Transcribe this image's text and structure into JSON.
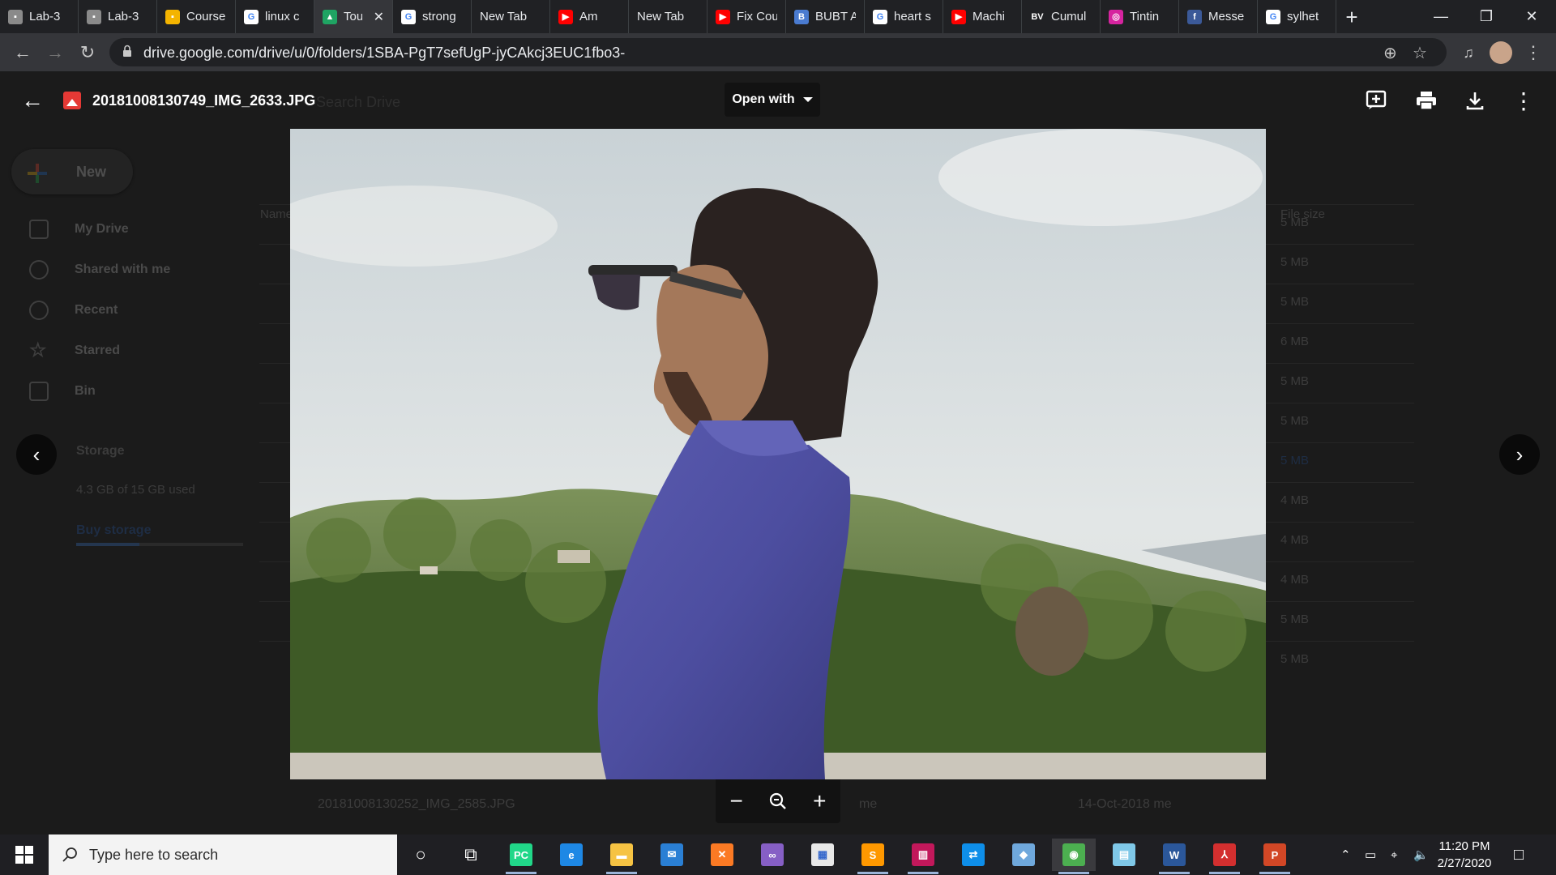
{
  "browser": {
    "tabs": [
      {
        "label": "Lab-3",
        "icon": "slides-icon",
        "color": "#8a8a8a",
        "glyph": "▪"
      },
      {
        "label": "Lab-3",
        "icon": "slides-icon",
        "color": "#8a8a8a",
        "glyph": "▪"
      },
      {
        "label": "Course",
        "icon": "classroom-icon",
        "color": "#f4b400",
        "glyph": "▪"
      },
      {
        "label": "linux c",
        "icon": "google-icon",
        "color": "#ffffff",
        "glyph": "G"
      },
      {
        "label": "Tou",
        "icon": "drive-icon",
        "color": "#1fa463",
        "glyph": "▲",
        "active": true
      },
      {
        "label": "strong",
        "icon": "google-icon",
        "color": "#ffffff",
        "glyph": "G"
      },
      {
        "label": "New Tab",
        "icon": "",
        "color": "",
        "glyph": ""
      },
      {
        "label": "Am",
        "icon": "youtube-icon",
        "color": "#ff0000",
        "glyph": "▶"
      },
      {
        "label": "New Tab",
        "icon": "",
        "color": "",
        "glyph": ""
      },
      {
        "label": "Fix Cou",
        "icon": "youtube-icon",
        "color": "#ff0000",
        "glyph": "▶"
      },
      {
        "label": "BUBT A",
        "icon": "bubt-icon",
        "color": "#4a7bd0",
        "glyph": "B"
      },
      {
        "label": "heart s",
        "icon": "google-icon",
        "color": "#ffffff",
        "glyph": "G"
      },
      {
        "label": "Machi",
        "icon": "youtube-icon",
        "color": "#ff0000",
        "glyph": "▶"
      },
      {
        "label": "Cumul",
        "icon": "bv-icon",
        "color": "#202124",
        "glyph": "BV"
      },
      {
        "label": "Tintin",
        "icon": "instagram-icon",
        "color": "#d6249f",
        "glyph": "◎"
      },
      {
        "label": "Messe",
        "icon": "facebook-icon",
        "color": "#3b5998",
        "glyph": "f"
      },
      {
        "label": "sylhet",
        "icon": "google-icon",
        "color": "#ffffff",
        "glyph": "G"
      }
    ],
    "url": "drive.google.com/drive/u/0/folders/1SBA-PgT7sefUgP-jyCAkcj3EUC1fbo3-"
  },
  "drive_background": {
    "new_label": "New",
    "search_placeholder": "Search Drive",
    "nav": [
      "My Drive",
      "Shared with me",
      "Recent",
      "Starred",
      "Bin"
    ],
    "storage_label": "Storage",
    "storage_used": "4.3 GB of 15 GB used",
    "buy_storage": "Buy storage",
    "column_name": "Name",
    "column_file_size": "File size",
    "file_sizes": [
      "5 MB",
      "5 MB",
      "5 MB",
      "6 MB",
      "5 MB",
      "5 MB",
      "5 MB",
      "4 MB",
      "4 MB",
      "4 MB",
      "5 MB",
      "5 MB"
    ],
    "last_row": {
      "name": "20181008130252_IMG_2585.JPG",
      "owner": "me",
      "modified": "14-Oct-2018 me"
    }
  },
  "viewer": {
    "filename": "20181008130749_IMG_2633.JPG",
    "open_with": "Open with"
  },
  "taskbar": {
    "search_placeholder": "Type here to search",
    "time": "11:20 PM",
    "date": "2/27/2020",
    "apps": [
      {
        "name": "cortana-icon",
        "color": "transparent",
        "glyph": "○"
      },
      {
        "name": "task-view-icon",
        "color": "transparent",
        "glyph": "⧉"
      },
      {
        "name": "pycharm-icon",
        "color": "#21d789",
        "glyph": "PC"
      },
      {
        "name": "edge-icon",
        "color": "#1e88e5",
        "glyph": "e"
      },
      {
        "name": "file-explorer-icon",
        "color": "#f6c343",
        "glyph": "▬"
      },
      {
        "name": "mail-icon",
        "color": "#2a7fd4",
        "glyph": "✉"
      },
      {
        "name": "xampp-icon",
        "color": "#fb7a24",
        "glyph": "✕"
      },
      {
        "name": "visual-studio-icon",
        "color": "#865fc5",
        "glyph": "∞"
      },
      {
        "name": "store-icon",
        "color": "#e8e8e8",
        "glyph": "▦"
      },
      {
        "name": "sublime-icon",
        "color": "#ff9800",
        "glyph": "S"
      },
      {
        "name": "winrar-icon",
        "color": "#c2185b",
        "glyph": "▥"
      },
      {
        "name": "teamviewer-icon",
        "color": "#0e8ee9",
        "glyph": "⇄"
      },
      {
        "name": "virtualbox-icon",
        "color": "#6fa8dc",
        "glyph": "◆"
      },
      {
        "name": "chrome-icon",
        "color": "#4caf50",
        "glyph": "◉"
      },
      {
        "name": "notepad-icon",
        "color": "#7fc8e8",
        "glyph": "▤"
      },
      {
        "name": "word-icon",
        "color": "#2b579a",
        "glyph": "W"
      },
      {
        "name": "acrobat-icon",
        "color": "#d32f2f",
        "glyph": "⅄"
      },
      {
        "name": "powerpoint-icon",
        "color": "#d24726",
        "glyph": "P"
      }
    ]
  }
}
